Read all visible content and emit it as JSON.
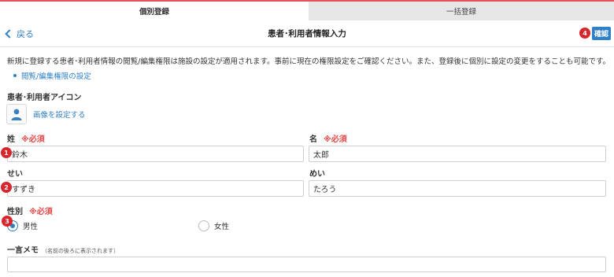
{
  "tabs": [
    {
      "label": "個別登録",
      "active": true
    },
    {
      "label": "一括登録",
      "active": false
    }
  ],
  "header": {
    "back_label": "戻る",
    "title": "患者･利用者情報入力",
    "confirm_label": "確認"
  },
  "notice": "新規に登録する患者･利用者情報の閲覧/編集権限は施設の設定が適用されます。事前に現在の権限設定をご確認ください。また、登録後に個別に設定の変更をすることも可能です。",
  "permission_link": "閲覧/編集権限の設定",
  "icon_section": {
    "label": "患者･利用者アイコン",
    "set_image_link": "画像を設定する",
    "avatar_icon": "person-icon"
  },
  "required_mark": "※必須",
  "fields": {
    "last_name": {
      "label": "姓",
      "value": "鈴木"
    },
    "first_name": {
      "label": "名",
      "value": "太郎"
    },
    "last_name_kana": {
      "label": "せい",
      "value": "すずき"
    },
    "first_name_kana": {
      "label": "めい",
      "value": "たろう"
    }
  },
  "gender": {
    "label": "性別",
    "options": [
      {
        "label": "男性",
        "selected": true
      },
      {
        "label": "女性",
        "selected": false
      }
    ]
  },
  "memo": {
    "label": "一言メモ",
    "note": "（名前の後ろに表示されます）",
    "value": ""
  },
  "markers": [
    "1",
    "2",
    "3",
    "4"
  ],
  "colors": {
    "accent": "#2f80c8",
    "link": "#2f7fc8",
    "required": "#e34a4a",
    "marker": "#d9262c",
    "tab_top_border": "#e8505b"
  }
}
